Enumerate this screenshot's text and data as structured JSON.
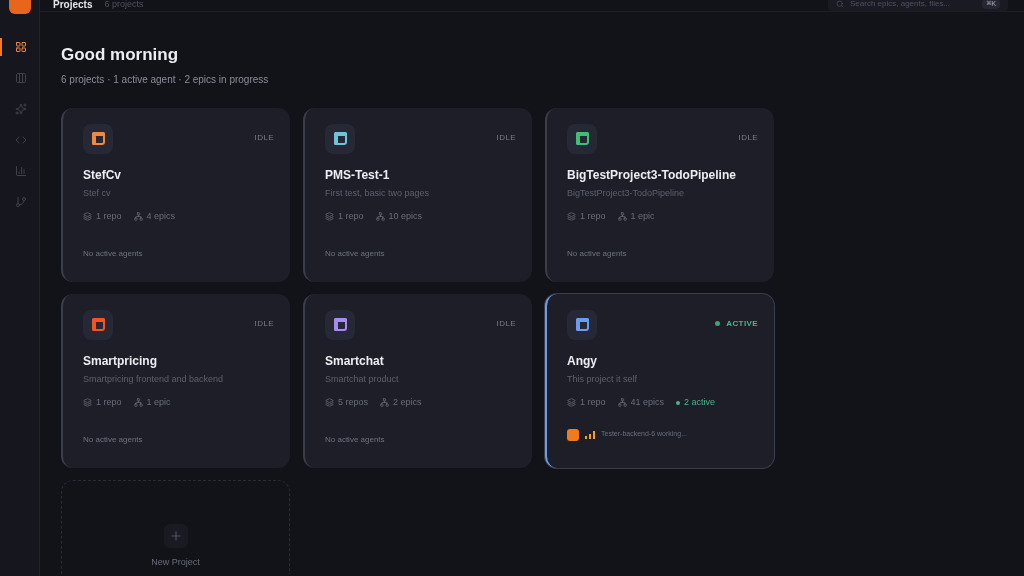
{
  "top_bar": {
    "title": "Projects",
    "count": "6 projects",
    "search": {
      "placeholder": "Search epics, agents, files...",
      "shortcut": "⌘K"
    }
  },
  "sidebar": {
    "items": [
      {
        "selected": true
      },
      {
        "selected": false
      },
      {
        "selected": false
      },
      {
        "selected": false
      },
      {
        "selected": false
      },
      {
        "selected": false
      }
    ]
  },
  "greeting": "Good morning",
  "summary": "6 projects · 1 active agent · 2 epics in progress",
  "projects": [
    {
      "name": "StefCv",
      "description": "Stef cv",
      "color": "#f0883e",
      "status": "IDLE",
      "active": false,
      "repos": "1 repo",
      "epics": "4 epics",
      "agents_note": "No active agents"
    },
    {
      "name": "PMS-Test-1",
      "description": "First test, basic two pages",
      "color": "#6cc5d6",
      "status": "IDLE",
      "active": false,
      "repos": "1 repo",
      "epics": "10 epics",
      "agents_note": "No active agents"
    },
    {
      "name": "BigTestProject3-TodoPipeline",
      "description": "BigTestProject3-TodoPipeline",
      "color": "#3fbf75",
      "status": "IDLE",
      "active": false,
      "repos": "1 repo",
      "epics": "1 epic",
      "agents_note": "No active agents"
    },
    {
      "name": "Smartpricing",
      "description": "Smartpricing frontend and backend",
      "color": "#f5541f",
      "status": "IDLE",
      "active": false,
      "repos": "1 repo",
      "epics": "1 epic",
      "agents_note": "No active agents"
    },
    {
      "name": "Smartchat",
      "description": "Smartchat product",
      "color": "#a58cf0",
      "status": "IDLE",
      "active": false,
      "repos": "5 repos",
      "epics": "2 epics",
      "agents_note": "No active agents"
    },
    {
      "name": "Angy",
      "description": "This project it self",
      "color": "#6b9cf0",
      "status": "ACTIVE",
      "active": true,
      "repos": "1 repo",
      "epics": "41 epics",
      "active_count": "2 active",
      "agents": [
        {
          "label": "Tester-backend-6 working..."
        }
      ]
    }
  ],
  "new_project": {
    "label": "New Project"
  }
}
